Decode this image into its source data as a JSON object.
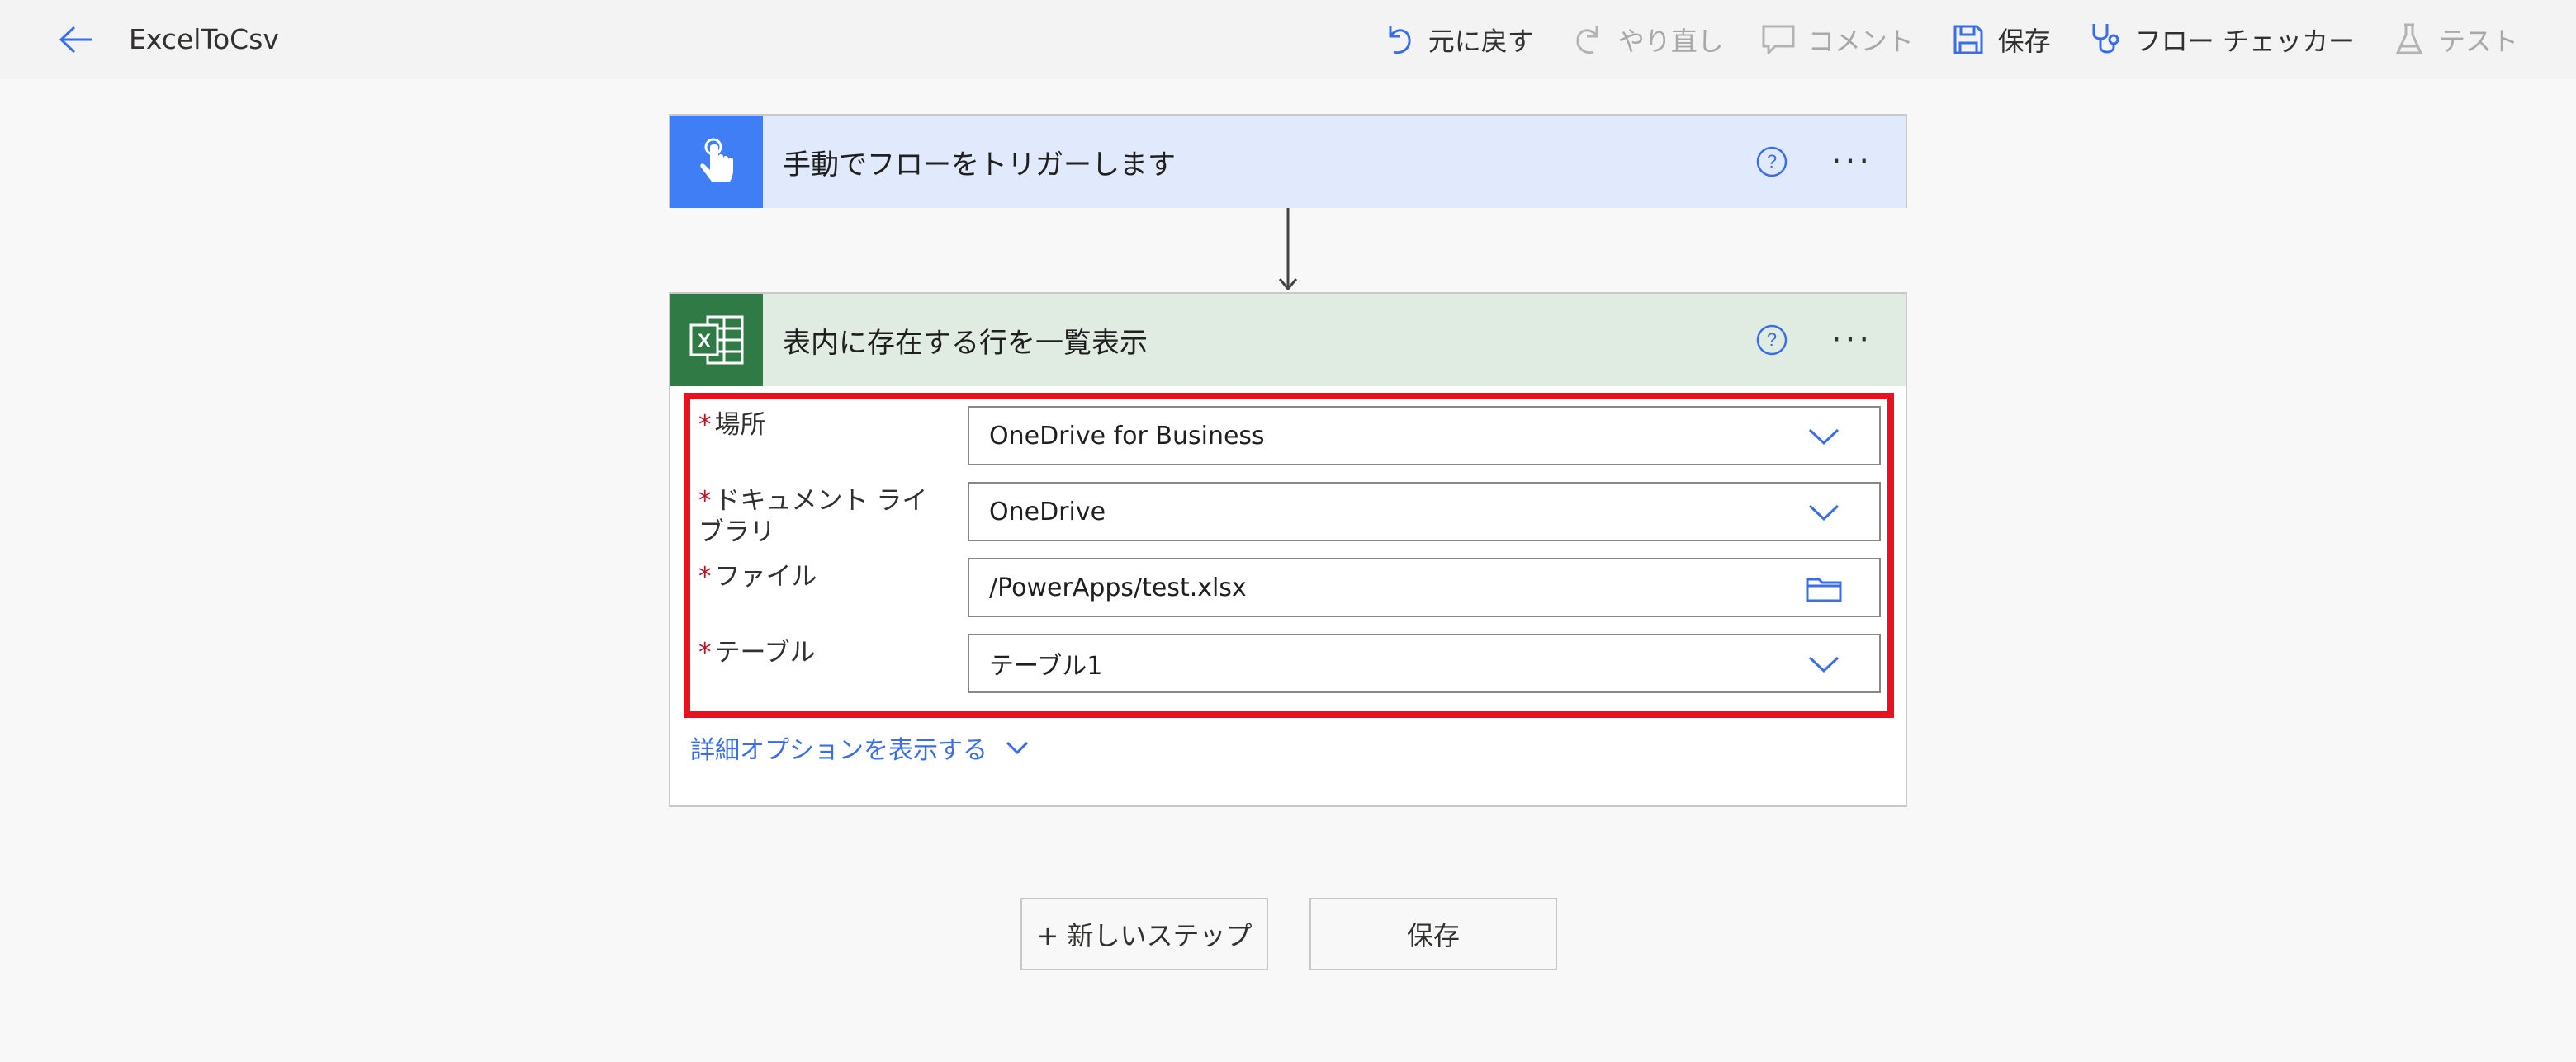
{
  "header": {
    "flow_title": "ExcelToCsv"
  },
  "toolbar": {
    "undo_label": "元に戻す",
    "redo_label": "やり直し",
    "comment_label": "コメント",
    "save_label": "保存",
    "flow_checker_label": "フロー チェッカー",
    "test_label": "テスト"
  },
  "trigger": {
    "title": "手動でフローをトリガーします",
    "more": "···"
  },
  "action": {
    "title": "表内に存在する行を一覧表示",
    "more": "···",
    "excel_letter": "X",
    "fields": [
      {
        "label": "場所",
        "value": "OneDrive for Business",
        "required_mark": "*"
      },
      {
        "label": "ドキュメント ライブラリ",
        "value": "OneDrive",
        "required_mark": "*"
      },
      {
        "label": "ファイル",
        "value": "/PowerApps/test.xlsx",
        "required_mark": "*"
      },
      {
        "label": "テーブル",
        "value": "テーブル1",
        "required_mark": "*"
      }
    ],
    "advanced_options_label": "詳細オプションを表示する"
  },
  "bottom": {
    "new_step_label": "+ 新しいステップ",
    "save_label": "保存"
  },
  "colors": {
    "accent": "#3a6ee8",
    "trigger_icon_bg": "#3f7ef5",
    "excel_icon_bg": "#2f7a45",
    "highlight": "#e0151f"
  }
}
